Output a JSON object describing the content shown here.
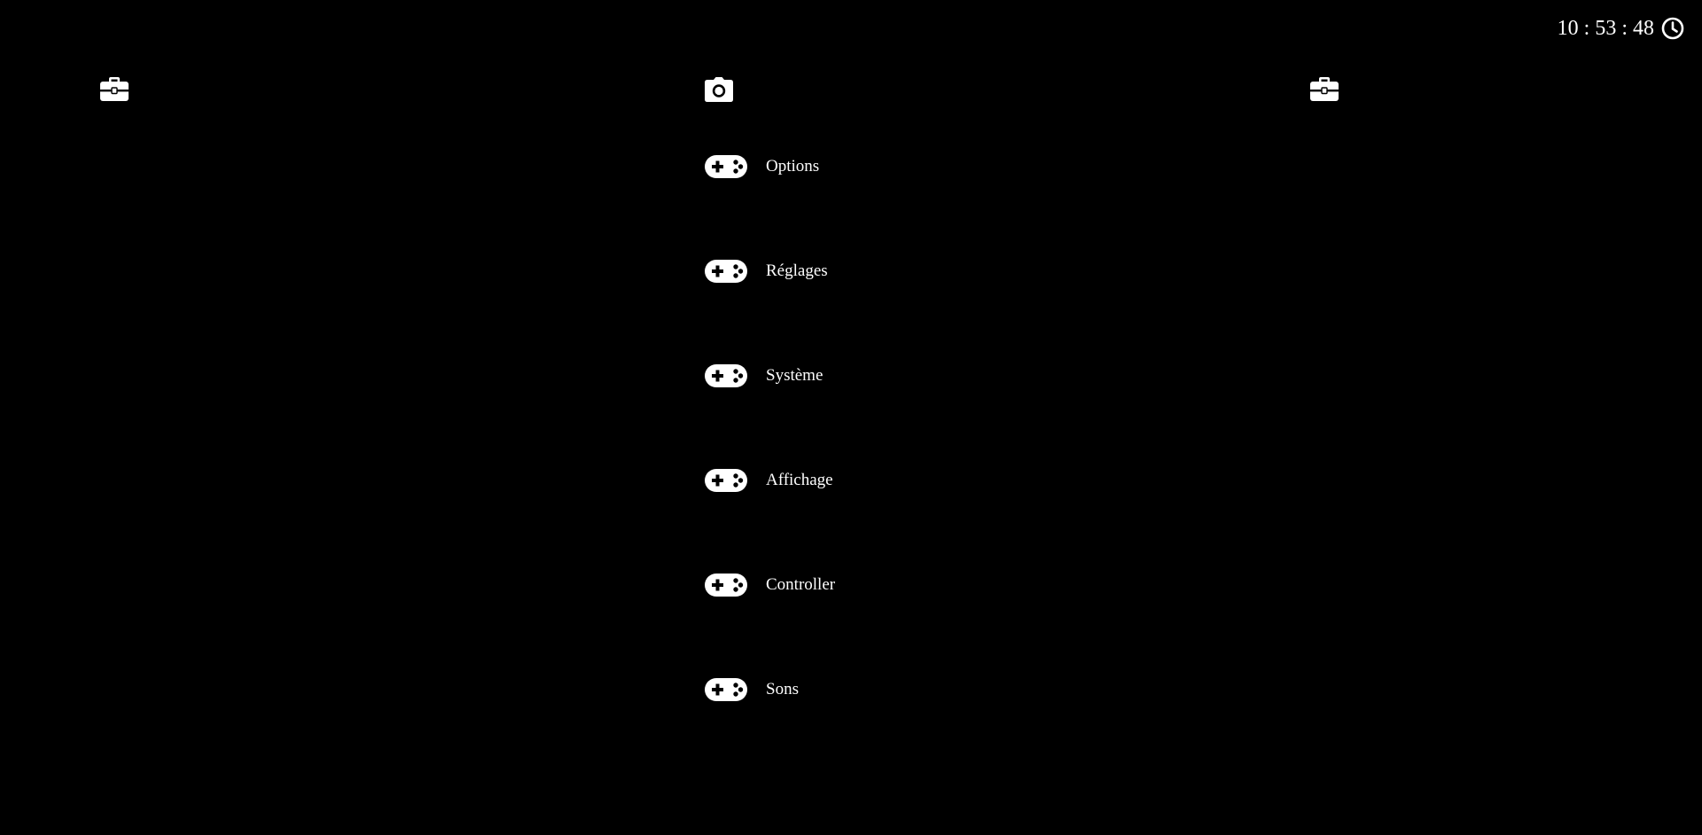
{
  "clock": {
    "time": "10 : 53 : 48",
    "icon": "clock-icon"
  },
  "categories": [
    {
      "icon": "toolbox-icon"
    },
    {
      "icon": "camera-icon"
    },
    {
      "icon": "toolbox-icon"
    }
  ],
  "menu": {
    "items": [
      {
        "label": "Options",
        "icon": "gamepad-icon"
      },
      {
        "label": "Réglages",
        "icon": "gamepad-icon"
      },
      {
        "label": "Système",
        "icon": "gamepad-icon"
      },
      {
        "label": "Affichage",
        "icon": "gamepad-icon"
      },
      {
        "label": "Controller",
        "icon": "gamepad-icon"
      },
      {
        "label": "Sons",
        "icon": "gamepad-icon"
      }
    ]
  },
  "colors": {
    "background": "#000000",
    "foreground": "#ffffff"
  }
}
